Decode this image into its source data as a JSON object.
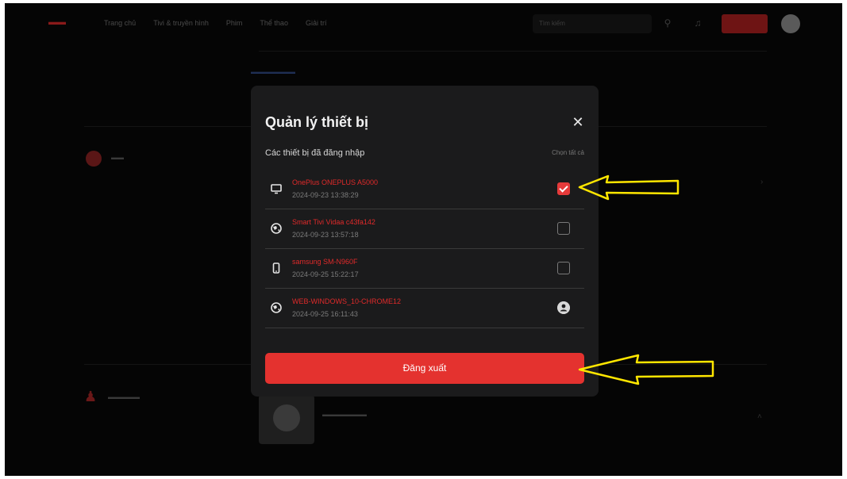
{
  "header": {
    "nav": [
      "Trang chủ",
      "Tivi & truyền hình",
      "Phim",
      "Thể thao",
      "Giải trí"
    ],
    "search_placeholder": "Tìm kiếm"
  },
  "modal": {
    "title": "Quản lý thiết bị",
    "subtitle": "Các thiết bị đã đăng nhập",
    "select_all": "Chọn tất cả",
    "devices": [
      {
        "name": "OnePlus ONEPLUS A5000",
        "time": "2024-09-23 13:38:29",
        "icon": "monitor-icon",
        "checked": true
      },
      {
        "name": "Smart Tivi Vidaa c43fa142",
        "time": "2024-09-23 13:57:18",
        "icon": "globe-icon",
        "checked": false
      },
      {
        "name": "samsung SM-N960F",
        "time": "2024-09-25 15:22:17",
        "icon": "phone-icon",
        "checked": false
      },
      {
        "name": "WEB-WINDOWS_10-CHROME12",
        "time": "2024-09-25 16:11:43",
        "icon": "globe-icon",
        "current": true
      }
    ],
    "logout_label": "Đăng xuất"
  },
  "colors": {
    "accent": "#e4322f",
    "device_name": "#e02a2a",
    "modal_bg": "#1b1b1c",
    "annotation_arrow": "#ffe600"
  }
}
